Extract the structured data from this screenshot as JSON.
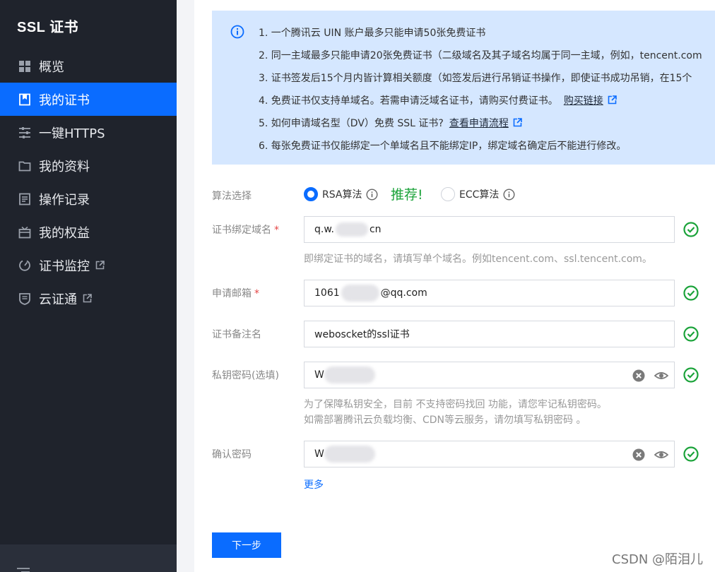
{
  "sidebar": {
    "brand": "SSL 证书",
    "items": [
      {
        "label": "概览",
        "icon": "grid-icon"
      },
      {
        "label": "我的证书",
        "icon": "certificate-icon",
        "active": true
      },
      {
        "label": "一键HTTPS",
        "icon": "sliders-icon"
      },
      {
        "label": "我的资料",
        "icon": "folder-icon"
      },
      {
        "label": "操作记录",
        "icon": "list-icon"
      },
      {
        "label": "我的权益",
        "icon": "gift-icon"
      },
      {
        "label": "证书监控",
        "icon": "monitor-icon",
        "external": true
      },
      {
        "label": "云证通",
        "icon": "shield-icon",
        "external": true
      }
    ]
  },
  "notice": {
    "lines": [
      "1. 一个腾讯云 UIN 账户最多只能申请50张免费证书",
      "2. 同一主域最多只能申请20张免费证书（二级域名及其子域名均属于同一主域，例如，tencent.com",
      "3. 证书签发后15个月内皆计算相关额度（如签发后进行吊销证书操作，即使证书成功吊销，在15个",
      "4. 免费证书仅支持单域名。若需申请泛域名证书，请购买付费证书。",
      "5. 如何申请域名型（DV）免费 SSL 证书?",
      "6. 每张免费证书仅能绑定一个单域名且不能绑定IP，绑定域名确定后不能进行修改。"
    ],
    "buy_link": "购买链接",
    "flow_link": "查看申请流程"
  },
  "form": {
    "algo_label": "算法选择",
    "rsa_label": "RSA算法",
    "recommend": "推荐!",
    "ecc_label": "ECC算法",
    "domain_label": "证书绑定域名",
    "domain_value_a": "q.w.",
    "domain_value_b": "cn",
    "domain_hint": "即绑定证书的域名，请填写单个域名。例如tencent.com、ssl.tencent.com。",
    "email_label": "申请邮箱",
    "email_value_a": "1061",
    "email_value_b": "@qq.com",
    "remark_label": "证书备注名",
    "remark_value": "weboscket的ssl证书",
    "key_label": "私钥密码(选填)",
    "key_value": "W",
    "key_hint_1": "为了保障私钥安全，目前 不支持密码找回 功能，请您牢记私钥密码。",
    "key_hint_2": "如需部署腾讯云负载均衡、CDN等云服务，请勿填写私钥密码 。",
    "confirm_label": "确认密码",
    "confirm_value": "W",
    "required_mark": "*",
    "more": "更多",
    "next": "下一步"
  },
  "colors": {
    "primary": "#0a6cff",
    "sidebar_bg": "#1f232c",
    "notice_bg": "#d5e7ff",
    "valid_green": "#1ba33a"
  },
  "watermark": "CSDN @陌泪儿"
}
